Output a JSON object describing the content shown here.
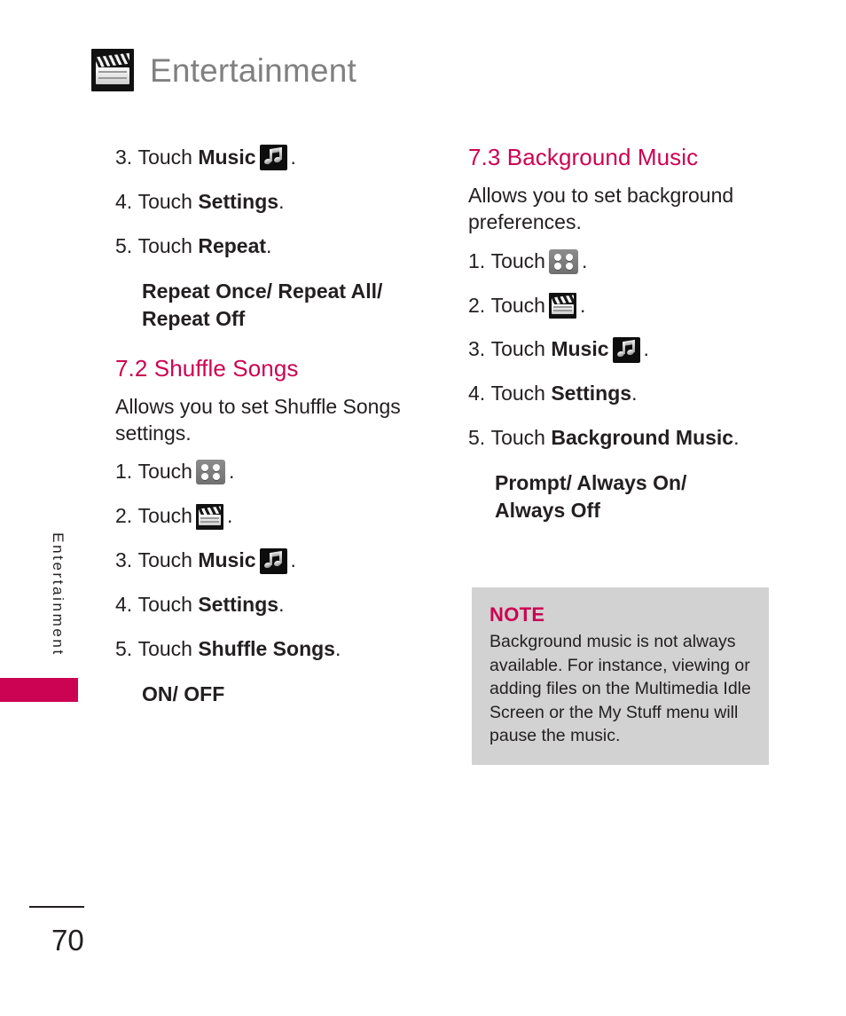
{
  "header": {
    "title": "Entertainment",
    "icon": "clapperboard-icon"
  },
  "side_tab": {
    "label": "Entertainment",
    "marker_color": "#cc0352"
  },
  "colors": {
    "accent": "#cc0352",
    "header_gray": "#808080",
    "note_background": "#d2d2d2",
    "body_text": "#231f20"
  },
  "left_column": {
    "steps_continued": [
      {
        "num": "3.",
        "verb": "Touch",
        "bold": "Music",
        "icon": "music-note-icon",
        "period": "."
      },
      {
        "num": "4.",
        "verb": "Touch",
        "bold": "Settings",
        "icon": null,
        "period": "."
      },
      {
        "num": "5.",
        "verb": "Touch",
        "bold": "Repeat",
        "icon": null,
        "period": "."
      }
    ],
    "options_continued": "Repeat Once/ Repeat All/\nRepeat Off",
    "section": {
      "heading": "7.2 Shuffle Songs",
      "description": "Allows you to set Shuffle Songs settings.",
      "steps": [
        {
          "num": "1.",
          "verb": "Touch",
          "bold": "",
          "icon": "grid-menu-icon",
          "period": "."
        },
        {
          "num": "2.",
          "verb": "Touch",
          "bold": "",
          "icon": "clapperboard-icon",
          "period": "."
        },
        {
          "num": "3.",
          "verb": "Touch",
          "bold": "Music",
          "icon": "music-note-icon",
          "period": "."
        },
        {
          "num": "4.",
          "verb": "Touch",
          "bold": "Settings",
          "icon": null,
          "period": "."
        },
        {
          "num": "5.",
          "verb": "Touch",
          "bold": "Shuffle Songs",
          "icon": null,
          "period": "."
        }
      ],
      "options": "ON/ OFF"
    }
  },
  "right_column": {
    "section": {
      "heading": "7.3 Background Music",
      "description": "Allows you to set background preferences.",
      "steps": [
        {
          "num": "1.",
          "verb": "Touch",
          "bold": "",
          "icon": "grid-menu-icon",
          "period": "."
        },
        {
          "num": "2.",
          "verb": "Touch",
          "bold": "",
          "icon": "clapperboard-icon",
          "period": "."
        },
        {
          "num": "3.",
          "verb": "Touch",
          "bold": "Music",
          "icon": "music-note-icon",
          "period": "."
        },
        {
          "num": "4.",
          "verb": "Touch",
          "bold": "Settings",
          "icon": null,
          "period": "."
        },
        {
          "num": "5.",
          "verb": "Touch",
          "bold": "Background Music",
          "icon": null,
          "period": "."
        }
      ],
      "options": "Prompt/ Always On/\nAlways Off"
    }
  },
  "note": {
    "label": "NOTE",
    "text": "Background music is not always available. For instance, viewing or adding files on the Multimedia Idle Screen or the My Stuff menu will pause the music."
  },
  "footer": {
    "page_number": "70"
  }
}
